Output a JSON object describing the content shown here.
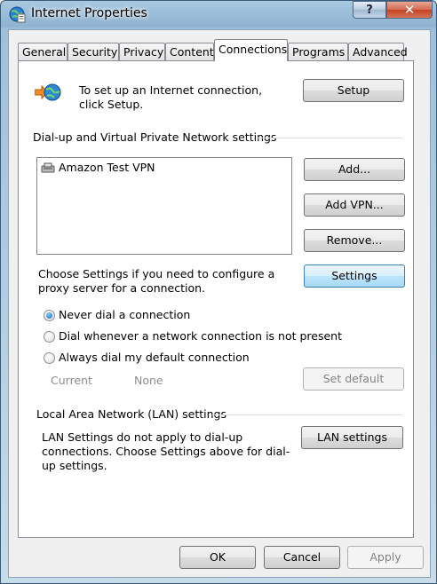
{
  "window": {
    "title": "Internet Properties",
    "help_label": "?",
    "close_label": "✕"
  },
  "tabs": [
    "General",
    "Security",
    "Privacy",
    "Content",
    "Connections",
    "Programs",
    "Advanced"
  ],
  "setup": {
    "text": "To set up an Internet connection, click Setup.",
    "button": "Setup"
  },
  "dialup": {
    "group_label": "Dial-up and Virtual Private Network settings",
    "connections": [
      "Amazon Test VPN"
    ],
    "add_button": "Add...",
    "add_vpn_button": "Add VPN...",
    "remove_button": "Remove...",
    "proxy_text": "Choose Settings if you need to configure a proxy server for a connection.",
    "settings_button": "Settings",
    "options": [
      {
        "label": "Never dial a connection",
        "checked": true
      },
      {
        "label": "Dial whenever a network connection is not present",
        "checked": false
      },
      {
        "label": "Always dial my default connection",
        "checked": false
      }
    ],
    "current_label": "Current",
    "current_value": "None",
    "set_default_button": "Set default"
  },
  "lan": {
    "group_label": "Local Area Network (LAN) settings",
    "text": "LAN Settings do not apply to dial-up connections. Choose Settings above for dial-up settings.",
    "button": "LAN settings"
  },
  "footer": {
    "ok": "OK",
    "cancel": "Cancel",
    "apply": "Apply"
  }
}
